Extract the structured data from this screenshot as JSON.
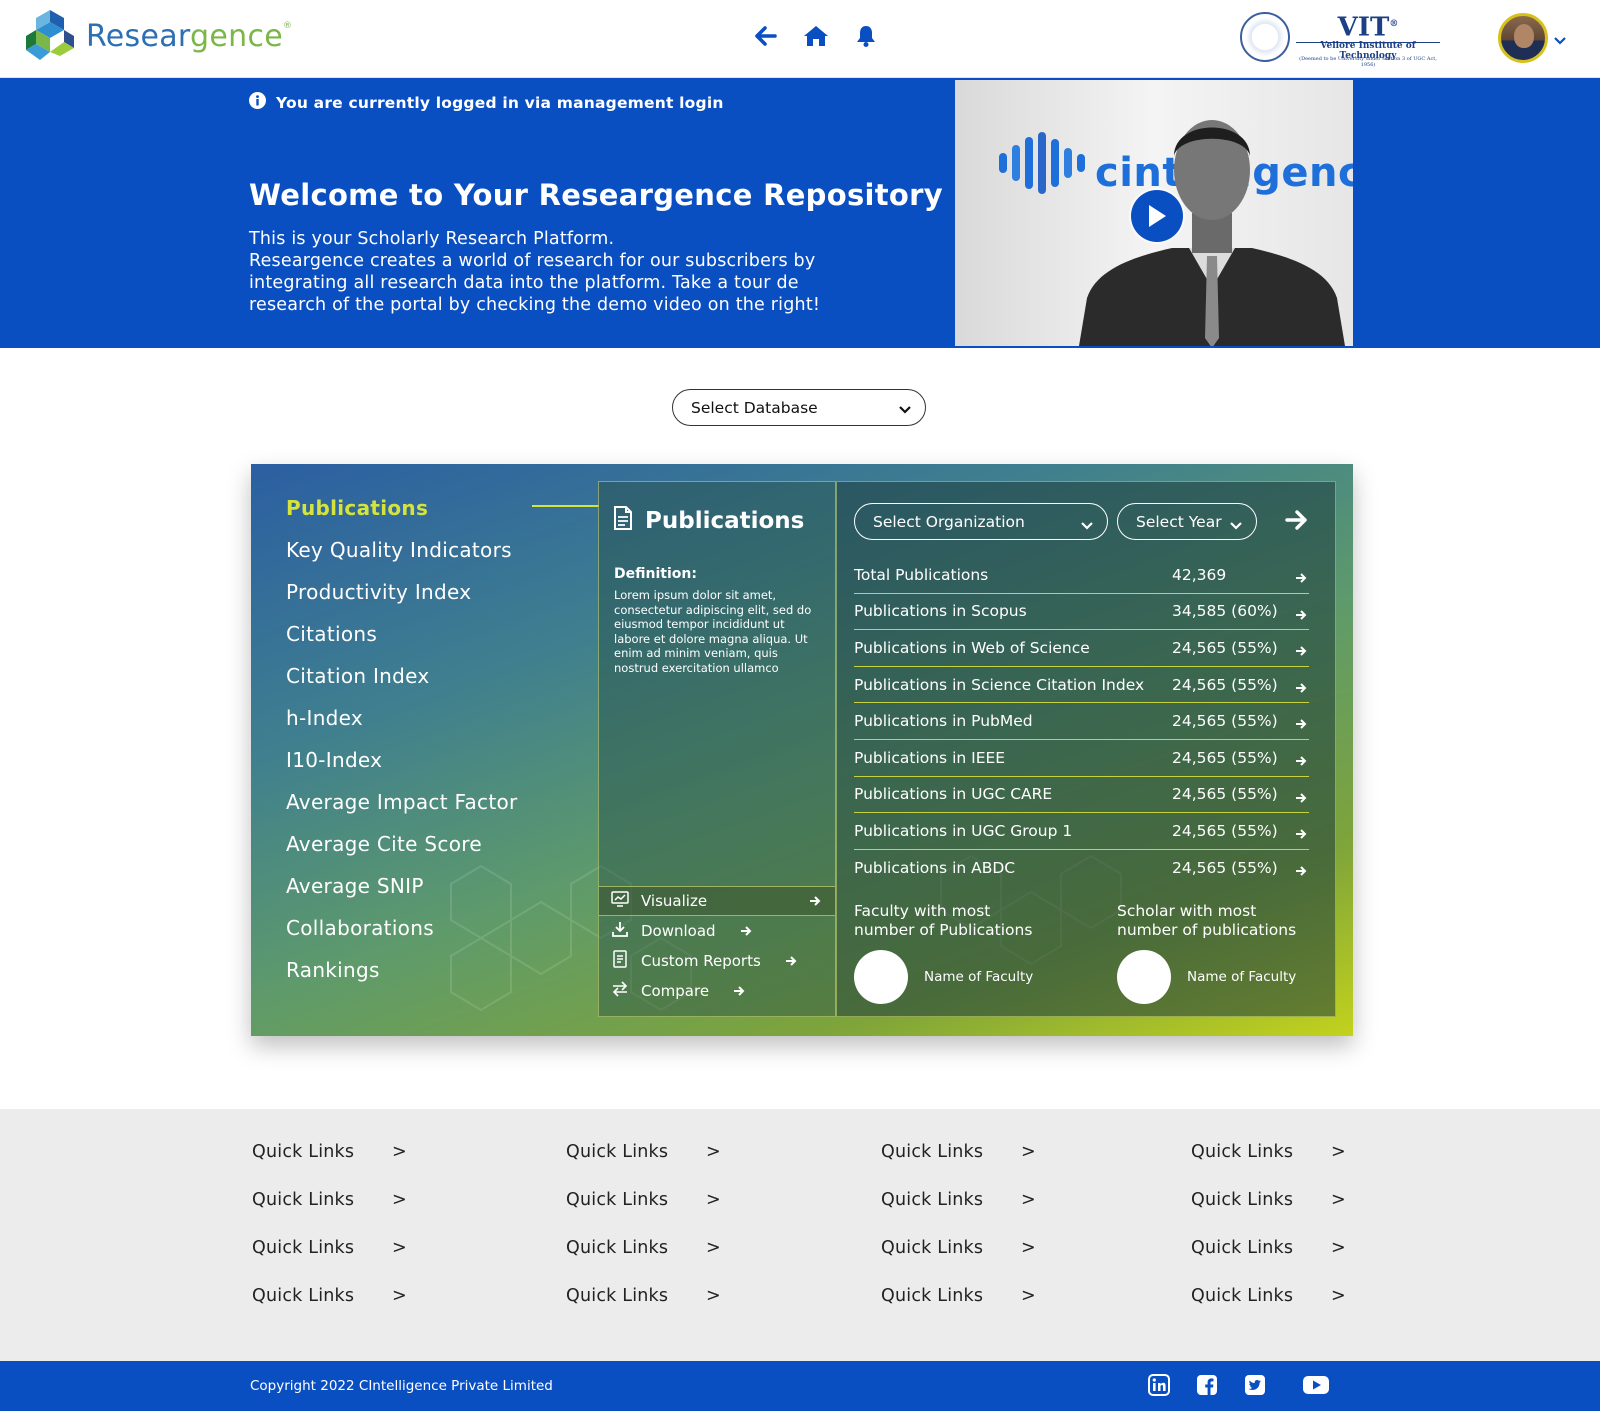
{
  "header": {
    "logo_text_a": "Resear",
    "logo_text_b": "gence",
    "logo_mark": "®",
    "nav_icons": [
      "back-arrow-icon",
      "home-icon",
      "bell-icon"
    ],
    "institution": {
      "short": "VIT",
      "reg": "®",
      "name": "Vellore Institute of Technology",
      "note": "(Deemed to be University under section 3 of UGC Act, 1956)"
    },
    "profile_caret": "chevron-down-icon"
  },
  "hero": {
    "notice": "You are currently logged in via management login",
    "title": "Welcome to Your Researgence Repository",
    "desc_line1": "This is your Scholarly Research Platform.",
    "desc_line2": "Researgence creates a world of research for our subscribers by integrating all research data into the platform.  Take a tour de research of the portal by checking the demo video on the right!",
    "video_brand": "cintelligence"
  },
  "database_select": {
    "value": "Select Database"
  },
  "panel": {
    "menu": [
      {
        "label": "Publications",
        "active": true
      },
      {
        "label": "Key Quality Indicators"
      },
      {
        "label": "Productivity Index"
      },
      {
        "label": "Citations"
      },
      {
        "label": "Citation Index"
      },
      {
        "label": "h-Index"
      },
      {
        "label": "I10-Index"
      },
      {
        "label": "Average Impact Factor"
      },
      {
        "label": "Average Cite Score"
      },
      {
        "label": "Average SNIP"
      },
      {
        "label": "Collaborations"
      },
      {
        "label": "Rankings"
      }
    ],
    "detail": {
      "title": "Publications",
      "definition_label": "Definition:",
      "definition_text": "Lorem ipsum dolor sit amet, consectetur adipiscing elit, sed do eiusmod tempor incididunt ut labore et dolore magna aliqua. Ut enim ad minim veniam, quis nostrud exercitation ullamco",
      "actions": [
        {
          "label": "Visualize",
          "icon": "visualize-icon"
        },
        {
          "label": "Download",
          "icon": "download-icon"
        },
        {
          "label": "Custom Reports",
          "icon": "report-icon"
        },
        {
          "label": "Compare",
          "icon": "compare-icon"
        }
      ]
    },
    "filters": {
      "organization": "Select Organization",
      "year": "Select Year"
    },
    "stats": [
      {
        "label": "Total Publications",
        "value": "42,369"
      },
      {
        "label": "Publications in Scopus",
        "value": "34,585 (60%)"
      },
      {
        "label": "Publications in Web of Science",
        "value": "24,565 (55%)"
      },
      {
        "label": "Publications in Science Citation Index",
        "value": "24,565 (55%)"
      },
      {
        "label": "Publications in PubMed",
        "value": "24,565 (55%)"
      },
      {
        "label": "Publications in IEEE",
        "value": "24,565 (55%)"
      },
      {
        "label": "Publications in UGC CARE",
        "value": "24,565 (55%)"
      },
      {
        "label": "Publications in UGC Group 1",
        "value": "24,565 (55%)"
      },
      {
        "label": "Publications in ABDC",
        "value": "24,565 (55%)"
      }
    ],
    "top_faculty": {
      "title_l1": "Faculty with most",
      "title_l2": "number of Publications",
      "name": "Name of Faculty"
    },
    "top_scholar": {
      "title_l1": "Scholar with most",
      "title_l2": "number of publications",
      "name": "Name of Faculty"
    }
  },
  "quick_links": {
    "label": "Quick Links",
    "chevron": ">"
  },
  "footer": {
    "copyright": "Copyright 2022 CIntelligence Private Limited",
    "socials": [
      "linkedin-icon",
      "facebook-icon",
      "twitter-icon",
      "youtube-icon"
    ]
  },
  "colors": {
    "brand_blue": "#0a4fc2",
    "accent_lime": "#d6e33a",
    "quick_links_bg": "#ececec"
  }
}
